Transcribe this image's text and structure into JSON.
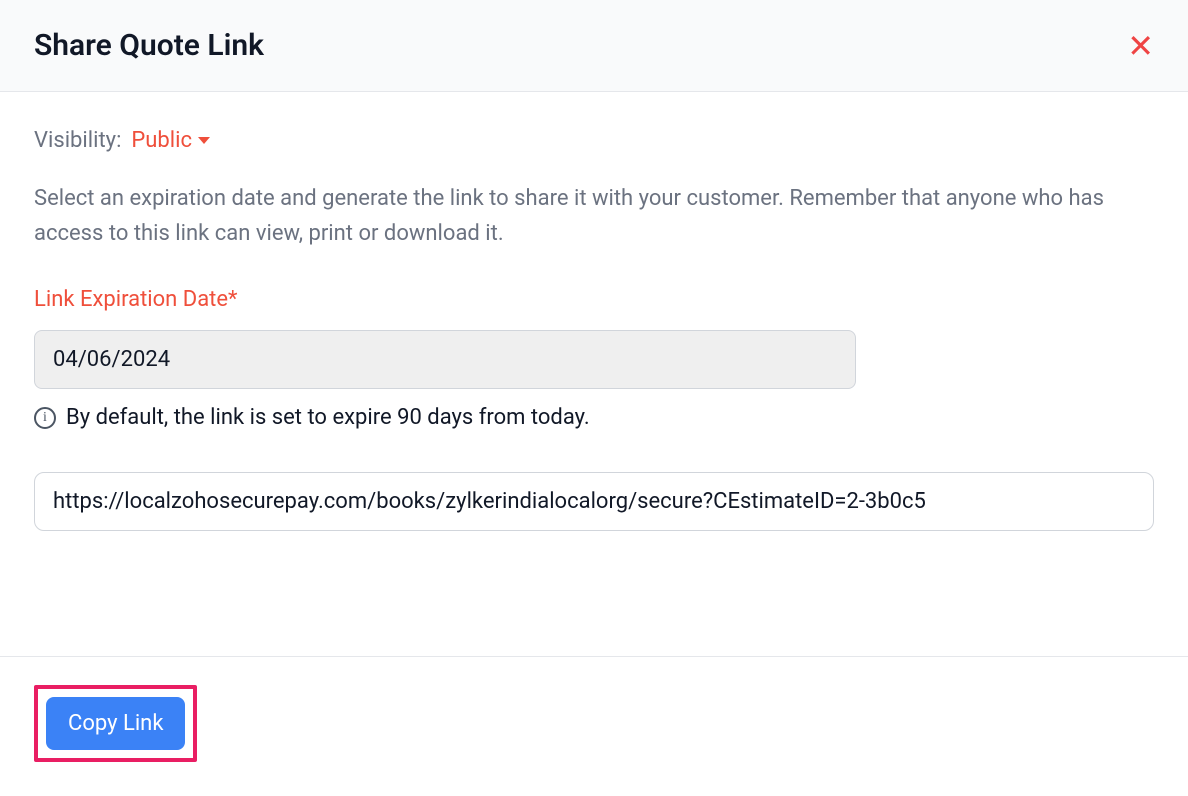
{
  "header": {
    "title": "Share Quote Link"
  },
  "visibility": {
    "label": "Visibility:",
    "value": "Public"
  },
  "description": "Select an expiration date and generate the link to share it with your customer. Remember that anyone who has access to this link can view, print or download it.",
  "expiration": {
    "label": "Link Expiration Date*",
    "value": "04/06/2024",
    "help": "By default, the link is set to expire 90 days from today."
  },
  "url": {
    "value": "https://localzohosecurepay.com/books/zylkerindialocalorg/secure?CEstimateID=2-3b0c5"
  },
  "buttons": {
    "copy": "Copy Link"
  }
}
